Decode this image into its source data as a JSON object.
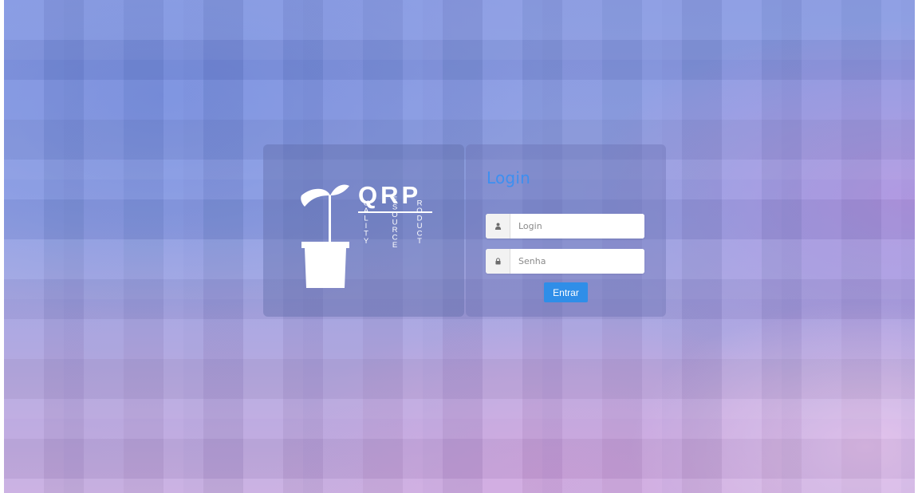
{
  "brand": {
    "name": "QRP",
    "columns": [
      "UALITY",
      "ESOURCE",
      "RODUCT"
    ]
  },
  "login_panel": {
    "title": "Login",
    "login_field": {
      "placeholder": "Login",
      "value": ""
    },
    "password_field": {
      "placeholder": "Senha",
      "value": ""
    },
    "submit_label": "Entrar"
  },
  "icons": {
    "login_field": "user-icon",
    "password_field": "lock-icon",
    "logo": "seedling-pot-icon"
  },
  "colors": {
    "accent": "#3d8ff0",
    "button": "#2f8ee8"
  }
}
